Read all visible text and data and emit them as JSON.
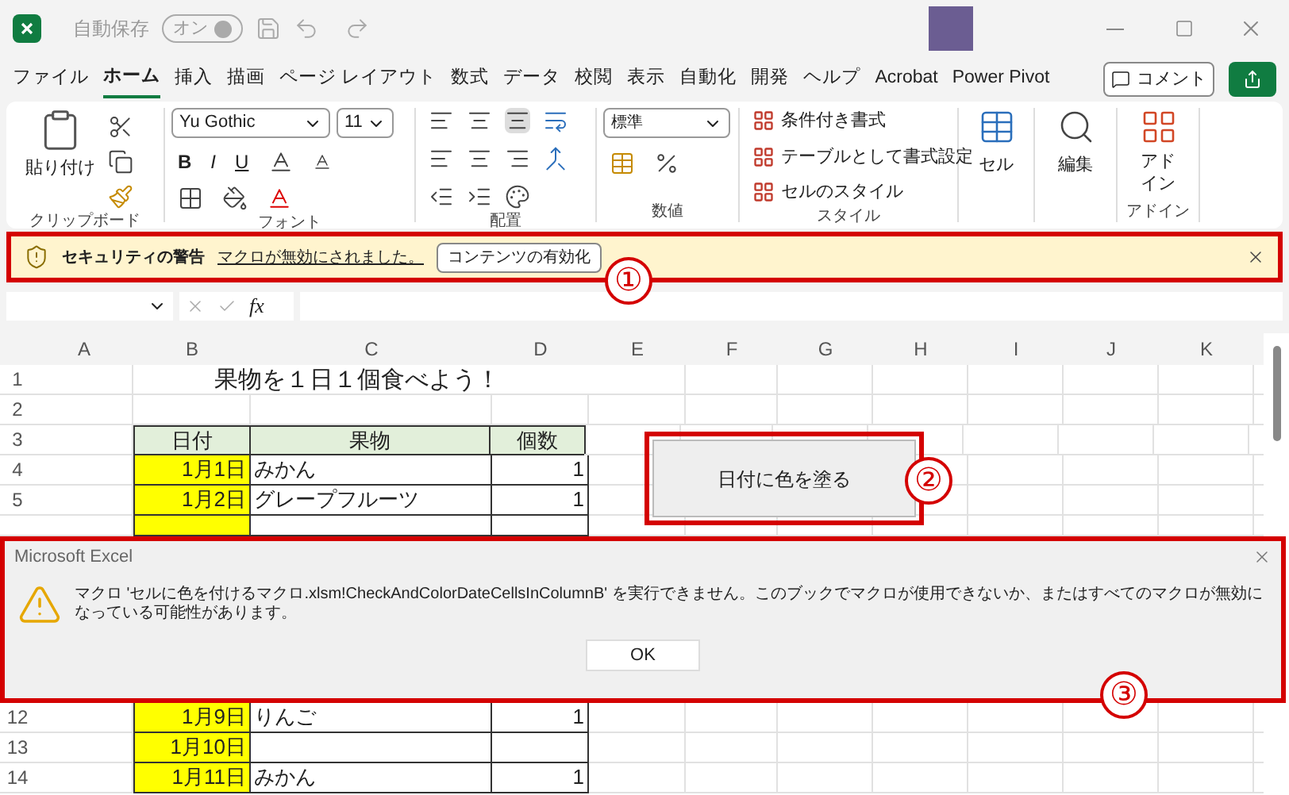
{
  "title_bar": {
    "autosave_label": "自動保存",
    "autosave_toggle": "オン"
  },
  "menu_tabs": [
    {
      "label": "ファイル",
      "selected": false
    },
    {
      "label": "ホーム",
      "selected": true
    },
    {
      "label": "挿入",
      "selected": false
    },
    {
      "label": "描画",
      "selected": false
    },
    {
      "label": "ページ レイアウト",
      "selected": false
    },
    {
      "label": "数式",
      "selected": false
    },
    {
      "label": "データ",
      "selected": false
    },
    {
      "label": "校閲",
      "selected": false
    },
    {
      "label": "表示",
      "selected": false
    },
    {
      "label": "自動化",
      "selected": false
    },
    {
      "label": "開発",
      "selected": false
    },
    {
      "label": "ヘルプ",
      "selected": false
    },
    {
      "label": "Acrobat",
      "selected": false
    },
    {
      "label": "Power Pivot",
      "selected": false
    }
  ],
  "comment_button": "コメント",
  "ribbon": {
    "clipboard": {
      "paste": "貼り付け",
      "label": "クリップボード"
    },
    "font": {
      "name": "Yu Gothic",
      "size": "11",
      "styles": [
        "B",
        "I",
        "U"
      ],
      "label": "フォント"
    },
    "alignment": {
      "label": "配置"
    },
    "number": {
      "format": "標準",
      "label": "数値"
    },
    "styles": {
      "items": [
        "条件付き書式",
        "テーブルとして書式設定",
        "セルのスタイル"
      ],
      "label": "スタイル"
    },
    "cells": {
      "button": "セル"
    },
    "editing": {
      "button": "編集"
    },
    "addins": {
      "button": "アドイン",
      "label": "アドイン"
    }
  },
  "security_bar": {
    "title": "セキュリティの警告",
    "message": "マクロが無効にされました。",
    "button": "コンテンツの有効化"
  },
  "formula_bar": {
    "fx": "fx"
  },
  "sheet": {
    "columns": [
      "A",
      "B",
      "C",
      "D",
      "E",
      "F",
      "G",
      "H",
      "I",
      "J",
      "K"
    ],
    "rows_top": [
      {
        "number": "1",
        "kind": "title",
        "text": "果物を１日１個食べよう！"
      },
      {
        "number": "2",
        "kind": "blank"
      },
      {
        "number": "3",
        "kind": "header",
        "cells": [
          "日付",
          "果物",
          "個数"
        ]
      },
      {
        "number": "4",
        "kind": "data",
        "date": "1月1日",
        "highlighted": true,
        "fruit": "みかん",
        "count": "1"
      },
      {
        "number": "5",
        "kind": "data",
        "date": "1月2日",
        "highlighted": true,
        "fruit": "グレープフルーツ",
        "count": "1"
      },
      {
        "kind": "partial",
        "highlighted": true
      }
    ],
    "rows_bottom": [
      {
        "number": "12",
        "kind": "data",
        "date": "1月9日",
        "highlighted": true,
        "fruit": "りんご",
        "count": "1"
      },
      {
        "number": "13",
        "kind": "data",
        "date": "1月10日",
        "highlighted": true
      },
      {
        "number": "14",
        "kind": "data",
        "date": "1月11日",
        "highlighted": true,
        "fruit": "みかん",
        "count": "1"
      }
    ],
    "macro_button": "日付に色を塗る"
  },
  "dialog": {
    "title": "Microsoft Excel",
    "message": "マクロ 'セルに色を付けるマクロ.xlsm!CheckAndColorDateCellsInColumnB' を実行できません。このブックでマクロが使用できないか、またはすべてのマクロが無効になっている可能性があります。",
    "button": "OK"
  },
  "annotations": [
    "①",
    "②",
    "③"
  ]
}
